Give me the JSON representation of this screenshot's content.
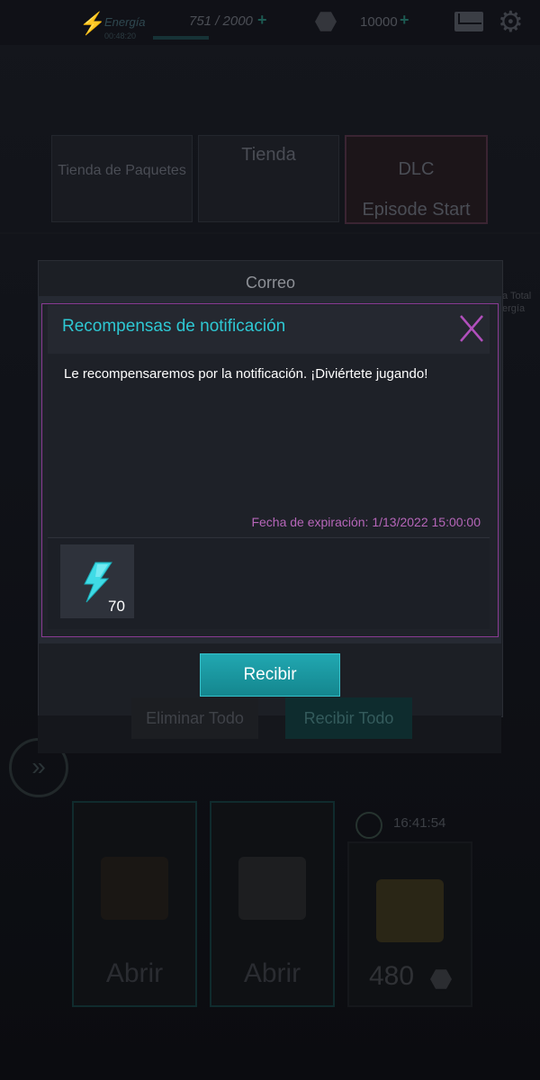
{
  "topbar": {
    "energy_label": "Energía",
    "energy_sub": "00:48:20",
    "energy_count": "751 / 2000",
    "energy_plus": "+",
    "gem_count": "10000",
    "gem_plus": "+"
  },
  "shop": {
    "packages_label": "Tienda de Paquetes",
    "store_label": "Tienda",
    "dlc_label": "DLC",
    "dlc_sub": "Episode Start"
  },
  "side_event": {
    "x_label": "X",
    "text": "a Total ergía"
  },
  "mail": {
    "title": "Correo",
    "delete_all": "Eliminar Todo",
    "receive_all": "Recibir Todo"
  },
  "chests": {
    "open_label_1": "Abrir",
    "open_label_2": "Abrir",
    "timer": "16:41:54",
    "price": "480"
  },
  "popup": {
    "title": "Recompensas de notificación",
    "message": "Le recompensaremos por la notificación. ¡Diviértete jugando!",
    "expiry": "Fecha de expiración: 1/13/2022 15:00:00",
    "reward_icon": "energy-bolt-icon",
    "reward_qty": "70",
    "receive_button": "Recibir"
  },
  "colors": {
    "accent_teal": "#2ec8d3",
    "accent_purple": "#b666b9",
    "button_teal": "#1a9aa4"
  }
}
